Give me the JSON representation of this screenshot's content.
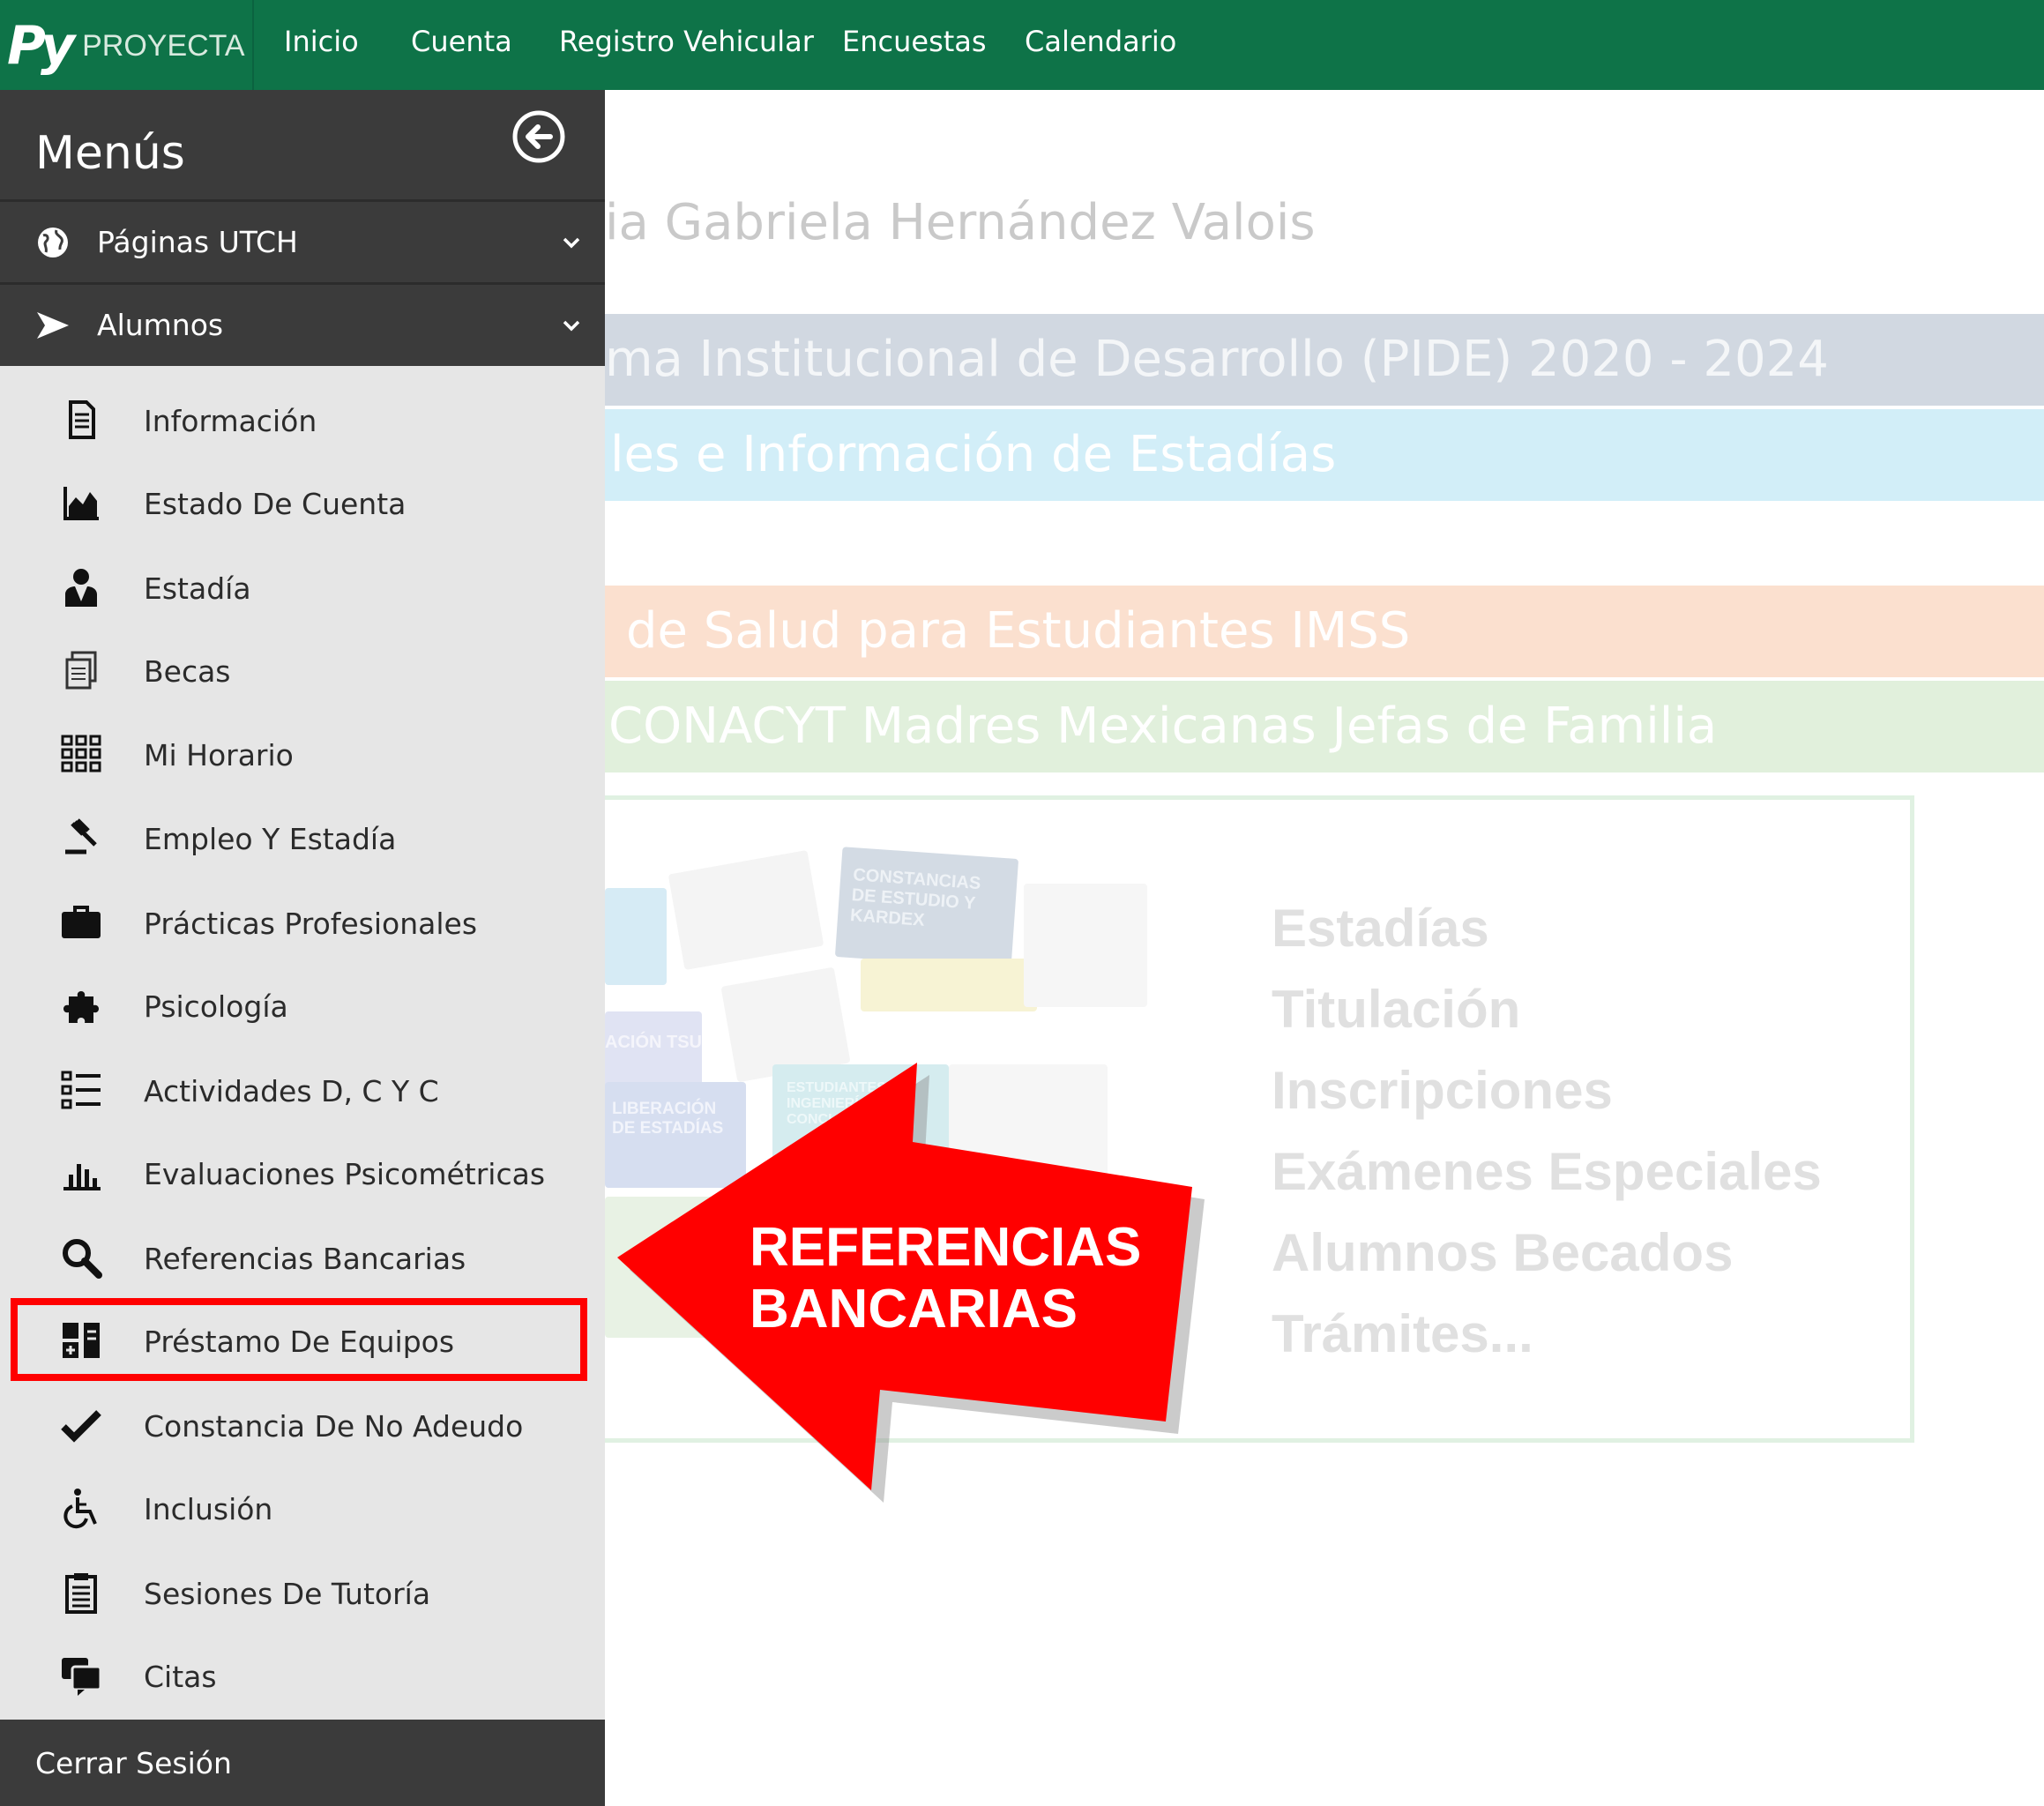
{
  "topnav": {
    "logo_mark": "Py",
    "logo_text": "PROYECTA",
    "links": [
      "Inicio",
      "Cuenta",
      "Registro Vehicular",
      "Encuestas",
      "Calendario"
    ]
  },
  "sidebar": {
    "title": "Menús",
    "sections": [
      {
        "label": "Páginas UTCH",
        "icon": "globe-icon"
      },
      {
        "label": "Alumnos",
        "icon": "arrow-right-icon"
      }
    ],
    "items": [
      {
        "label": "Información",
        "icon": "document-icon"
      },
      {
        "label": "Estado De Cuenta",
        "icon": "area-chart-icon"
      },
      {
        "label": "Estadía",
        "icon": "user-tie-icon"
      },
      {
        "label": "Becas",
        "icon": "copy-icon"
      },
      {
        "label": "Mi Horario",
        "icon": "grid-icon"
      },
      {
        "label": "Empleo Y Estadía",
        "icon": "gavel-icon"
      },
      {
        "label": "Prácticas Profesionales",
        "icon": "briefcase-icon"
      },
      {
        "label": "Psicología",
        "icon": "puzzle-icon"
      },
      {
        "label": "Actividades D, C Y C",
        "icon": "list-icon"
      },
      {
        "label": "Evaluaciones Psicométricas",
        "icon": "bar-chart-icon"
      },
      {
        "label": "Referencias Bancarias",
        "icon": "search-icon"
      },
      {
        "label": "Préstamo De Equipos",
        "icon": "devices-icon"
      },
      {
        "label": "Constancia De No Adeudo",
        "icon": "check-icon"
      },
      {
        "label": "Inclusión",
        "icon": "wheelchair-icon"
      },
      {
        "label": "Sesiones De Tutoría",
        "icon": "clipboard-icon"
      },
      {
        "label": "Citas",
        "icon": "chat-icon"
      }
    ],
    "logout_label": "Cerrar Sesión"
  },
  "main": {
    "greeting": "ia Gabriela Hernández Valois",
    "banners": [
      "ma Institucional de Desarrollo (PIDE) 2020 - 2024",
      "les e Información de Estadías",
      "de Salud para Estudiantes IMSS",
      "CONACYT Madres Mexicanas Jefas de Familia"
    ],
    "promo_list": [
      "Estadías",
      "Titulación",
      "Inscripciones",
      "Exámenes Especiales",
      "Alumnos Becados",
      "Trámites..."
    ],
    "promo_cards": [
      "CONSTANCIAS DE ESTUDIO Y KARDEX",
      "ACIÓN TSU",
      "LIBERACIÓN DE ESTADÍAS",
      "ESTUDIANTES DE INGENIERÍA A CONCLUI ESTA"
    ]
  },
  "annotation": {
    "line1": "REFERENCIAS",
    "line2": "BANCARIAS"
  },
  "colors": {
    "topnav": "#0e7348",
    "sidebar_dark": "#3b3b3b",
    "sidebar_light": "#e6e6e6",
    "highlight": "#ff0000"
  }
}
